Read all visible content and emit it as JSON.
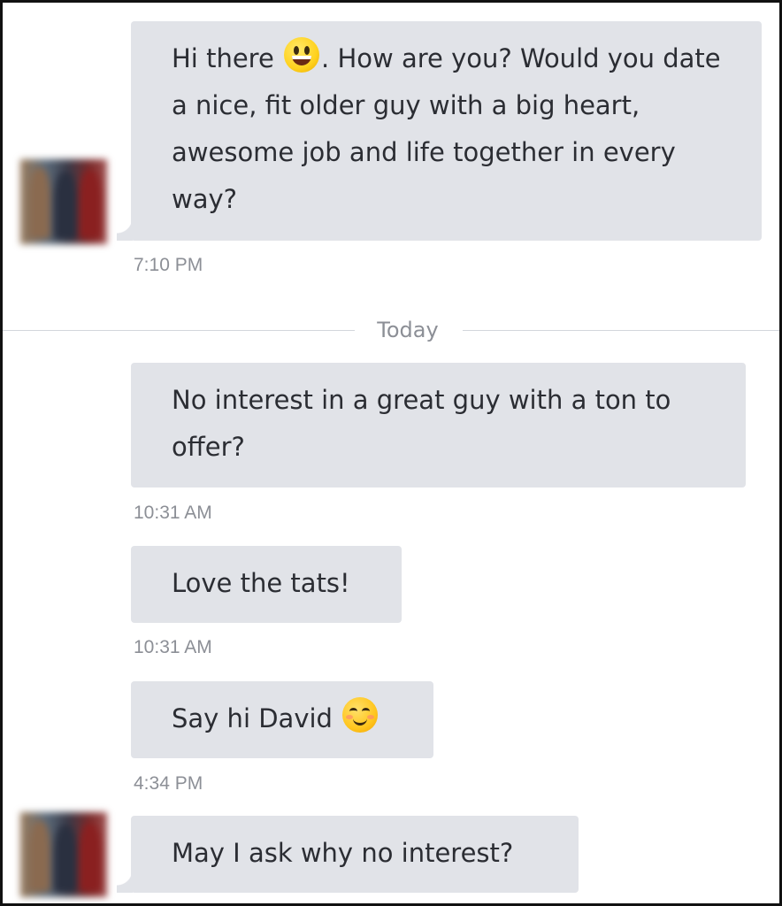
{
  "divider": {
    "label": "Today"
  },
  "messages": [
    {
      "text_before_emoji": "Hi there ",
      "emoji": "grinning-face",
      "text_after_emoji": ". How are you? Would you date a nice, fit older guy with a big heart, awesome job and life together in every way?",
      "time": "7:10 PM"
    },
    {
      "text": "No interest in a great guy with a ton to offer?",
      "time": "10:31 AM"
    },
    {
      "text": "Love the tats!",
      "time": "10:31 AM"
    },
    {
      "text": "Say hi David ",
      "emoji": "smiling-face-with-smiling-eyes",
      "time": "4:34 PM"
    },
    {
      "text": "May I ask why no interest?"
    }
  ],
  "colors": {
    "bubble": "#e1e3e8",
    "text": "#2b2d33",
    "timestamp": "#8c8f96",
    "divider": "#d3d6dc",
    "frame_border": "#111111"
  }
}
